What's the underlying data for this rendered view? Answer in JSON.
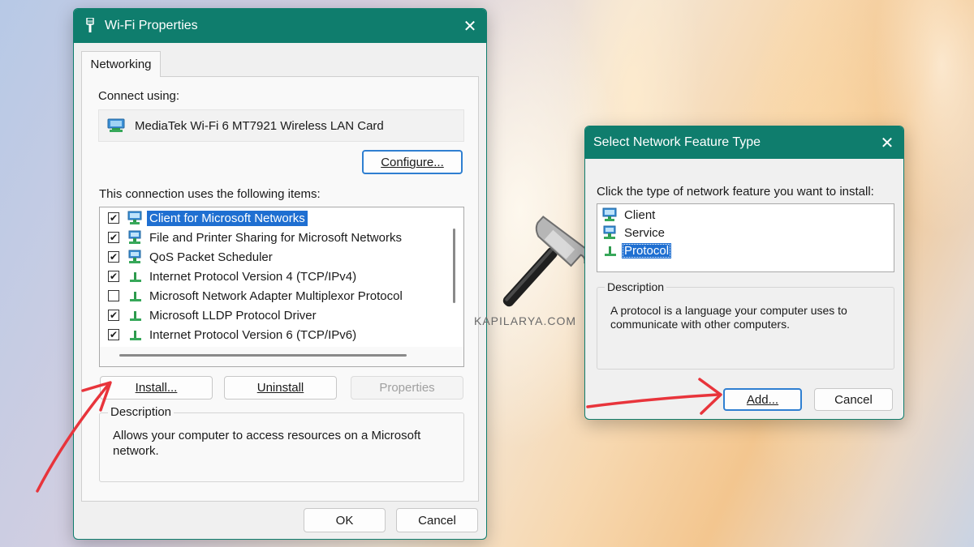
{
  "wifi_properties": {
    "title": "Wi-Fi Properties",
    "tab": "Networking",
    "connect_using_label": "Connect using:",
    "adapter_name": "MediaTek Wi-Fi 6 MT7921 Wireless LAN Card",
    "configure_button": "Configure...",
    "items_label": "This connection uses the following items:",
    "items": [
      {
        "label": "Client for Microsoft Networks",
        "checked": "✔",
        "icon": "network-client-icon"
      },
      {
        "label": "File and Printer Sharing for Microsoft Networks",
        "checked": "✔",
        "icon": "network-service-icon"
      },
      {
        "label": "QoS Packet Scheduler",
        "checked": "✔",
        "icon": "network-service-icon"
      },
      {
        "label": "Internet Protocol Version 4 (TCP/IPv4)",
        "checked": "✔",
        "icon": "protocol-icon"
      },
      {
        "label": "Microsoft Network Adapter Multiplexor Protocol",
        "checked": "",
        "icon": "protocol-icon"
      },
      {
        "label": "Microsoft LLDP Protocol Driver",
        "checked": "✔",
        "icon": "protocol-icon"
      },
      {
        "label": "Internet Protocol Version 6 (TCP/IPv6)",
        "checked": "✔",
        "icon": "protocol-icon"
      }
    ],
    "install_button": "Install...",
    "uninstall_button": "Uninstall",
    "properties_button": "Properties",
    "description_label": "Description",
    "description_text": "Allows your computer to access resources on a Microsoft network.",
    "ok_button": "OK",
    "cancel_button": "Cancel"
  },
  "feature_dialog": {
    "title": "Select Network Feature Type",
    "prompt": "Click the type of network feature you want to install:",
    "features": [
      {
        "label": "Client",
        "icon": "network-client-icon"
      },
      {
        "label": "Service",
        "icon": "network-service-icon"
      },
      {
        "label": "Protocol",
        "icon": "protocol-icon"
      }
    ],
    "description_label": "Description",
    "description_text": "A protocol is a language your computer uses to communicate with other computers.",
    "add_button": "Add...",
    "cancel_button": "Cancel"
  },
  "watermark": "KAPILARYA.COM",
  "colors": {
    "titlebar": "#0f7d6d",
    "selection": "#1f6fd1",
    "annotation_arrow": "#e8343b"
  }
}
